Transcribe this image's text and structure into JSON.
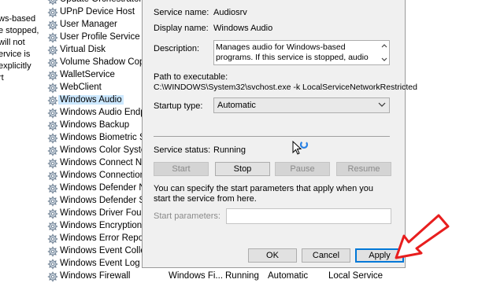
{
  "left_description_lines": [
    "ws-based",
    "e stopped,",
    "will not",
    "ervice is",
    "explicitly",
    "rt"
  ],
  "services": [
    {
      "name": "Update Orchestrator Ser"
    },
    {
      "name": "UPnP Device Host"
    },
    {
      "name": "User Manager"
    },
    {
      "name": "User Profile Service"
    },
    {
      "name": "Virtual Disk"
    },
    {
      "name": "Volume Shadow Copy"
    },
    {
      "name": "WalletService"
    },
    {
      "name": "WebClient"
    },
    {
      "name": "Windows Audio",
      "selected": true
    },
    {
      "name": "Windows Audio Endpo"
    },
    {
      "name": "Windows Backup"
    },
    {
      "name": "Windows Biometric Se"
    },
    {
      "name": "Windows Color System"
    },
    {
      "name": "Windows Connect Nov"
    },
    {
      "name": "Windows Connection"
    },
    {
      "name": "Windows Defender Ne"
    },
    {
      "name": "Windows Defender Se"
    },
    {
      "name": "Windows Driver Found"
    },
    {
      "name": "Windows Encryption P"
    },
    {
      "name": "Windows Error Reporti"
    },
    {
      "name": "Windows Event Collect"
    },
    {
      "name": "Windows Event Log"
    },
    {
      "name": "Windows Firewall"
    }
  ],
  "bottom_row": {
    "description": "Windows Fi...",
    "status": "Running",
    "startup": "Automatic",
    "logon": "Local Service"
  },
  "dialog": {
    "service_name_label": "Service name:",
    "service_name": "Audiosrv",
    "display_name_label": "Display name:",
    "display_name": "Windows Audio",
    "description_label": "Description:",
    "description": "Manages audio for Windows-based programs.  If this service is stopped, audio devices and effects will not",
    "path_label": "Path to executable:",
    "path": "C:\\WINDOWS\\System32\\svchost.exe -k LocalServiceNetworkRestricted",
    "startup_type_label": "Startup type:",
    "startup_type": "Automatic",
    "service_status_label": "Service status:",
    "service_status": "Running",
    "start_label": "Start",
    "stop_label": "Stop",
    "pause_label": "Pause",
    "resume_label": "Resume",
    "hint": "You can specify the start parameters that apply when you start the service from here.",
    "start_params_label": "Start parameters:",
    "start_params_value": "",
    "ok_label": "OK",
    "cancel_label": "Cancel",
    "apply_label": "Apply"
  },
  "colors": {
    "accent": "#0078d7",
    "arrow": "#e81e1e",
    "selection": "#cce8ff",
    "dialog_bg": "#f0f0f0"
  }
}
